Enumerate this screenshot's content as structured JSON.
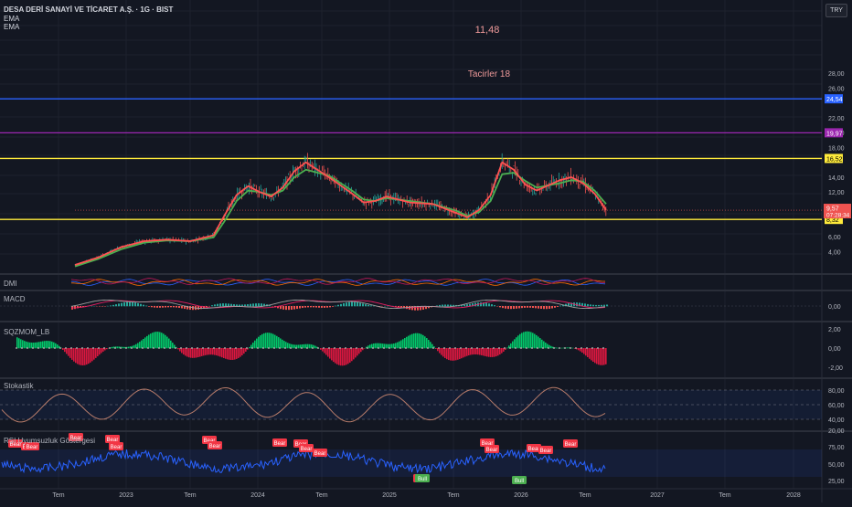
{
  "header": {
    "title": "DESA DERİ SANAYİ VE TİCARET A.Ş. · 1G · BIST",
    "ind1": "EMA",
    "ind2": "EMA",
    "currency": "TRY"
  },
  "annotations": {
    "price_note": "11,48",
    "note2": "Tacirler 18"
  },
  "price_axis": {
    "ticks": [
      "28,00",
      "26,00",
      "22,00",
      "20,00",
      "18,00",
      "14,00",
      "12,00",
      "6,00",
      "4,00"
    ],
    "levels": [
      {
        "label": "24,54",
        "value": 24.54,
        "color": "#2962ff",
        "text_color": "#ffffff"
      },
      {
        "label": "19,97",
        "value": 19.97,
        "color": "#9c27b0",
        "text_color": "#ffffff"
      },
      {
        "label": "16,52",
        "value": 16.52,
        "color": "#ffeb3b",
        "text_color": "#000000"
      },
      {
        "label": "8,32",
        "value": 8.32,
        "color": "#ffeb3b",
        "text_color": "#000000"
      }
    ],
    "last_price": "9,57",
    "countdown": "07:28:34"
  },
  "panes": {
    "dmi": {
      "label": "DMI"
    },
    "macd": {
      "label": "MACD",
      "ticks": [
        "0,00"
      ]
    },
    "sqzmom": {
      "label": "SQZMOM_LB",
      "ticks": [
        "2,00",
        "0,00",
        "-2,00"
      ]
    },
    "stoch": {
      "label": "Stokastik",
      "ticks": [
        "80,00",
        "60,00",
        "40,00",
        "20,00"
      ]
    },
    "rsi": {
      "label": "RSI Uyumsuzluk Göstergesi",
      "ticks": [
        "75,00",
        "50,00",
        "25,00"
      ],
      "signals": [
        "Bear",
        "Bear",
        "Bear",
        "Bear",
        "Bear",
        "Bear",
        "Bear",
        "Bear",
        "Bear",
        "Bear",
        "Bear",
        "Bear",
        "Bear",
        "Bull",
        "Bear",
        "Bear",
        "Bear",
        "Bull",
        "Bear",
        "Bear"
      ]
    }
  },
  "time_axis": [
    "Tem",
    "2023",
    "Tem",
    "2024",
    "Tem",
    "2025",
    "Tem",
    "2026",
    "Tem",
    "2027",
    "Tem",
    "2028"
  ],
  "colors": {
    "background": "#131722",
    "candle_up": "#26a69a",
    "candle_down": "#ef5350",
    "ema_fast": "#ff5252",
    "ema_slow": "#4caf50",
    "rsi_line": "#2962ff",
    "stoch_line": "#b87c6a",
    "sqz_up": "#00e676",
    "sqz_down": "#ff1744"
  },
  "chart_data": {
    "type": "line",
    "title": "DESA DERİ SANAYİ VE TİCARET A.Ş. · 1G · BIST",
    "xlabel": "",
    "ylabel": "",
    "x": [
      "2022-07",
      "2022-09",
      "2022-11",
      "2023-01",
      "2023-03",
      "2023-05",
      "2023-07",
      "2023-08",
      "2023-09",
      "2023-10",
      "2023-11",
      "2023-12",
      "2024-01",
      "2024-02",
      "2024-03",
      "2024-05",
      "2024-07",
      "2024-08",
      "2024-09",
      "2024-10",
      "2024-12",
      "2025-02",
      "2025-04",
      "2025-05",
      "2025-06",
      "2025-07",
      "2025-08",
      "2025-09",
      "2025-10",
      "2025-11",
      "2026-01",
      "2026-02",
      "2026-03",
      "2026-04",
      "2026-05"
    ],
    "series": [
      {
        "values": [
          2.2,
          3.2,
          4.6,
          5.4,
          5.6,
          5.4,
          6.2,
          9.0,
          11.6,
          12.8,
          12.0,
          11.4,
          12.6,
          14.8,
          16.0,
          14.0,
          11.8,
          10.6,
          10.8,
          11.4,
          10.6,
          10.4,
          9.2,
          8.6,
          9.6,
          11.6,
          16.0,
          15.0,
          13.0,
          12.2,
          13.6,
          14.0,
          13.2,
          11.8,
          9.6
        ]
      },
      {
        "values": [
          2.0,
          3.0,
          4.3,
          5.2,
          5.5,
          5.4,
          5.9,
          8.2,
          10.8,
          12.2,
          12.0,
          11.6,
          12.2,
          14.0,
          15.0,
          14.2,
          12.2,
          11.0,
          10.8,
          11.2,
          10.8,
          10.4,
          9.5,
          8.8,
          9.3,
          10.8,
          14.4,
          14.6,
          13.5,
          12.6,
          13.2,
          13.6,
          13.4,
          12.2,
          10.4
        ]
      }
    ],
    "ylim": [
      2,
      30
    ],
    "grid": true
  }
}
